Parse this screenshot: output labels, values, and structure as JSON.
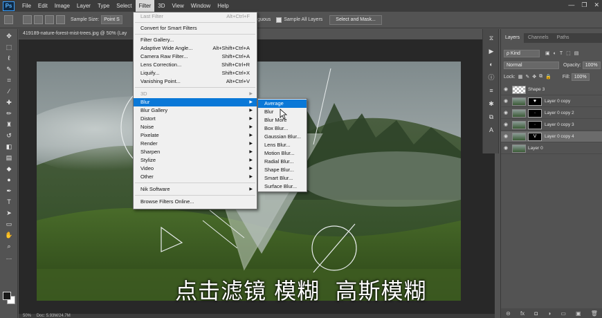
{
  "app": {
    "logo": "Ps"
  },
  "menubar": {
    "items": [
      "File",
      "Edit",
      "Image",
      "Layer",
      "Type",
      "Select",
      "Filter",
      "3D",
      "View",
      "Window",
      "Help"
    ],
    "active": "Filter"
  },
  "window_controls": {
    "minimize": "—",
    "maximize": "❐",
    "close": "✕"
  },
  "options_bar": {
    "sample_size_label": "Sample Size:",
    "sample_size_value": "Point S",
    "contiguous_label": "Contiguous",
    "sample_all_layers_label": "Sample All Layers",
    "select_and_mask": "Select and Mask..."
  },
  "document": {
    "tab_title": "419189-nature-forest-mist-trees.jpg @ 50% (Lay",
    "caption": "点击滤镜 模糊  高斯模糊",
    "status_zoom": "50%",
    "status_doc": "Doc: 5.93M/24.7M"
  },
  "filter_menu": {
    "last_filter": "Last Filter",
    "last_filter_shortcut": "Alt+Ctrl+F",
    "convert_smart": "Convert for Smart Filters",
    "filter_gallery": "Filter Gallery...",
    "adaptive_wide": "Adaptive Wide Angle...",
    "adaptive_wide_shortcut": "Alt+Shift+Ctrl+A",
    "camera_raw": "Camera Raw Filter...",
    "camera_raw_shortcut": "Shift+Ctrl+A",
    "lens_correction": "Lens Correction...",
    "lens_correction_shortcut": "Shift+Ctrl+R",
    "liquify": "Liquify...",
    "liquify_shortcut": "Shift+Ctrl+X",
    "vanishing_point": "Vanishing Point...",
    "vanishing_point_shortcut": "Alt+Ctrl+V",
    "three_d": "3D",
    "blur": "Blur",
    "blur_gallery": "Blur Gallery",
    "distort": "Distort",
    "noise": "Noise",
    "pixelate": "Pixelate",
    "render": "Render",
    "sharpen": "Sharpen",
    "stylize": "Stylize",
    "video": "Video",
    "other": "Other",
    "nik_software": "Nik Software",
    "browse_online": "Browse Filters Online..."
  },
  "blur_submenu": {
    "items": [
      "Average",
      "Blur",
      "Blur More",
      "Box Blur...",
      "Gaussian Blur...",
      "Lens Blur...",
      "Motion Blur...",
      "Radial Blur...",
      "Shape Blur...",
      "Smart Blur...",
      "Surface Blur..."
    ],
    "highlighted": "Average"
  },
  "layers_panel": {
    "tabs": [
      "Layers",
      "Channels",
      "Paths"
    ],
    "active_tab": "Layers",
    "kind_label": "ρ Kind",
    "blend_mode": "Normal",
    "opacity_label": "Opacity:",
    "opacity_value": "100%",
    "lock_label": "Lock:",
    "fill_label": "Fill:",
    "fill_value": "100%",
    "layers": [
      {
        "name": "Shape 3",
        "selected": false
      },
      {
        "name": "Layer 0 copy",
        "selected": false
      },
      {
        "name": "Layer 0 copy 2",
        "selected": false
      },
      {
        "name": "Layer 0 copy 3",
        "selected": false
      },
      {
        "name": "Layer 0 copy 4",
        "selected": true
      },
      {
        "name": "Layer 0",
        "selected": false
      }
    ],
    "footer_icons": [
      "link-icon",
      "fx-icon",
      "mask-icon",
      "adjustment-icon",
      "group-icon",
      "new-layer-icon",
      "trash-icon"
    ],
    "footer_glyphs": [
      "⊝",
      "fx",
      "◘",
      "◑",
      "▭",
      "▣",
      "🗑"
    ]
  },
  "colors": {
    "accent": "#0a78d7",
    "menu_bg": "#f0f0f0",
    "ui_dark": "#535353"
  }
}
